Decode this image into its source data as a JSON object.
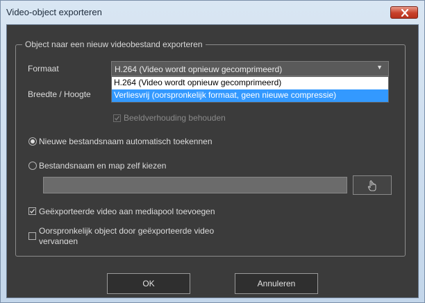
{
  "window": {
    "title": "Video-object exporteren"
  },
  "group": {
    "legend": "Object naar een nieuw videobestand exporteren"
  },
  "format": {
    "label": "Formaat",
    "selected": "H.264 (Video wordt opnieuw gecomprimeerd)",
    "options": [
      "H.264 (Video wordt opnieuw gecomprimeerd)",
      "Verliesvrij (oorspronkelijk formaat, geen nieuwe compressie)"
    ],
    "highlighted_index": 1
  },
  "size": {
    "label": "Breedte / Hoogte"
  },
  "aspect": {
    "label": "Beeldverhouding behouden",
    "checked": true,
    "enabled": false
  },
  "naming": {
    "auto_label": "Nieuwe bestandsnaam automatisch toekennen",
    "manual_label": "Bestandsnaam en map zelf kiezen",
    "selected": "auto",
    "path_value": ""
  },
  "options": {
    "add_to_pool_label": "Geëxporteerde video aan mediapool toevoegen",
    "add_to_pool_checked": true,
    "replace_label_line1": "Oorspronkelijk object door geëxporteerde video",
    "replace_label_line2": "vervangen",
    "replace_checked": false
  },
  "buttons": {
    "ok": "OK",
    "cancel": "Annuleren"
  },
  "colors": {
    "background": "#3b3b3b",
    "highlight": "#3399ff",
    "close": "#c7412b"
  }
}
